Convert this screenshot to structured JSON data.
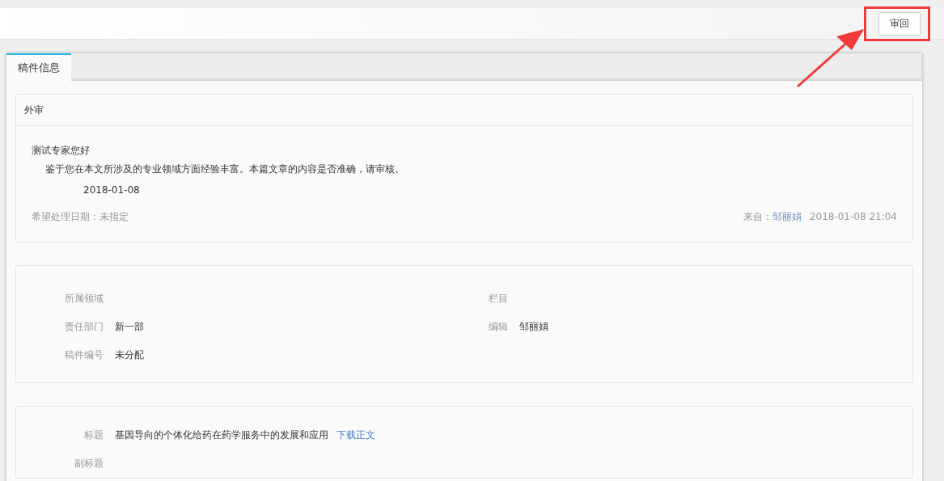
{
  "top_bar": {
    "buttons": [
      {
        "label": "审回"
      }
    ]
  },
  "tabs": [
    {
      "label": "稿件信息",
      "selected": true
    }
  ],
  "review": {
    "title": "外审",
    "greeting": "测试专家您好",
    "body": "鉴于您在本文所涉及的专业领域方面经验丰富。本篇文章的内容是否准确，请审核。",
    "date": "2018-01-08",
    "due": "希望处理日期：未指定",
    "from_label": "来自：",
    "from_name": "邹丽娟",
    "time": "2018-01-08 21:04"
  },
  "info": {
    "left": [
      {
        "label": "所属领域"
      },
      {
        "label": "责任部门",
        "value": "新一部"
      },
      {
        "label": "稿件编号",
        "value": "未分配"
      }
    ],
    "right": [
      {
        "label": "栏目"
      },
      {
        "label": "编辑",
        "value": "邹丽娟"
      }
    ]
  },
  "article": {
    "fields": [
      {
        "label": "标题",
        "value": "基因导向的个体化给药在药学服务中的发展和应用",
        "link": "下载正文"
      },
      {
        "label": "副标题"
      }
    ]
  }
}
